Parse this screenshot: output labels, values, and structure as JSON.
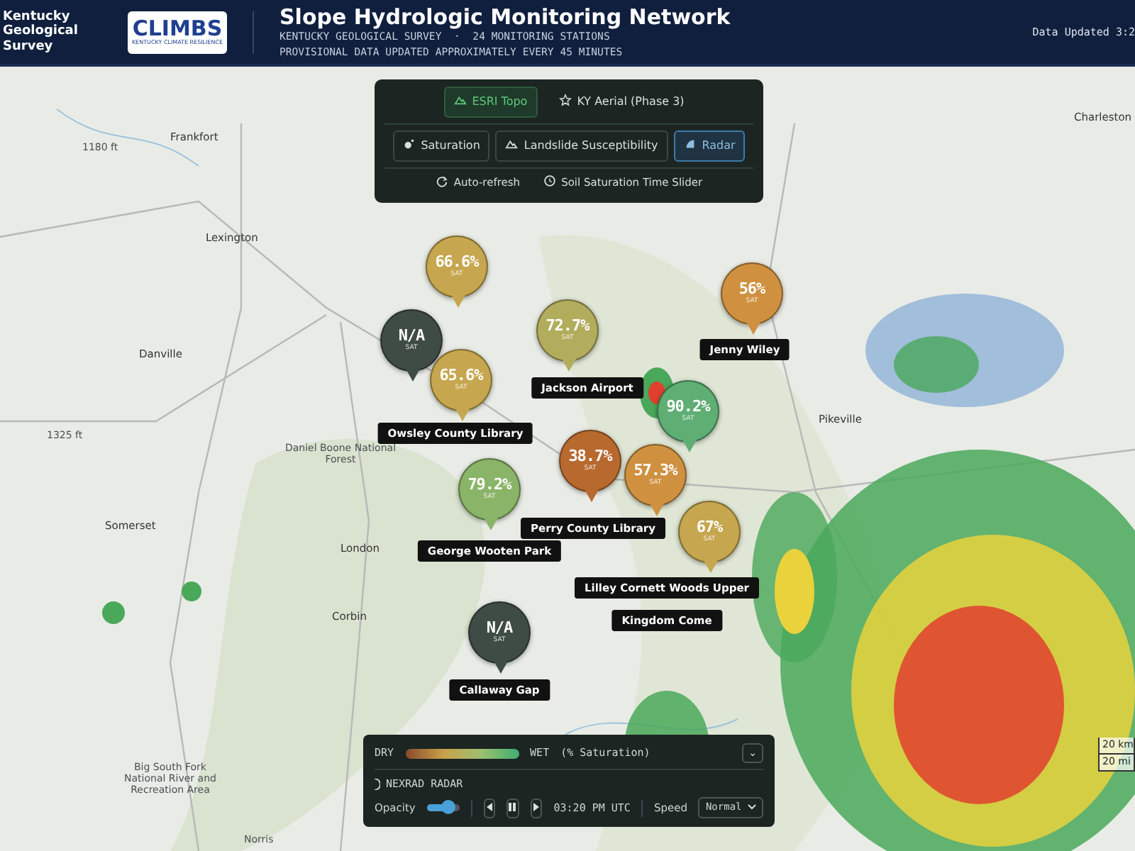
{
  "header": {
    "org_name": "Kentucky Geological Survey",
    "partner_logo": {
      "name": "CLIMBS",
      "tagline": "KENTUCKY CLIMATE RESILIENCE"
    },
    "title": "Slope Hydrologic Monitoring Network",
    "subtitle_1": "KENTUCKY GEOLOGICAL SURVEY  ·  24 MONITORING STATIONS",
    "subtitle_2": "PROVISIONAL DATA UPDATED APPROXIMATELY EVERY 45 MINUTES",
    "updated": "Data Updated 3:2"
  },
  "basemaps": [
    {
      "label": "ESRI Topo",
      "selected": true
    },
    {
      "label": "KY Aerial (Phase 3)",
      "selected": false
    }
  ],
  "layers": [
    {
      "label": "Saturation",
      "selected": false
    },
    {
      "label": "Landslide Susceptibility",
      "selected": false
    },
    {
      "label": "Radar",
      "selected": true
    }
  ],
  "options": [
    {
      "label": "Auto-refresh"
    },
    {
      "label": "Soil Saturation Time Slider"
    }
  ],
  "places": [
    {
      "text": "Charleston"
    },
    {
      "text": "Frankfort"
    },
    {
      "text": "1180 ft"
    },
    {
      "text": "Lexington"
    },
    {
      "text": "Danville"
    },
    {
      "text": "Daniel Boone National Forest"
    },
    {
      "text": "1325 ft"
    },
    {
      "text": "Pikeville"
    },
    {
      "text": "Somerset"
    },
    {
      "text": "London"
    },
    {
      "text": "Corbin"
    },
    {
      "text": "Big South Fork National River and Recreation Area"
    },
    {
      "text": "Norris"
    }
  ],
  "stations": [
    {
      "value": "66.6%",
      "unit": "SAT",
      "color": "#c6a64e"
    },
    {
      "value": "N/A",
      "unit": "SAT",
      "color": "#3f4b45"
    },
    {
      "value": "65.6%",
      "unit": "SAT",
      "color": "#c6a64e"
    },
    {
      "value": "72.7%",
      "unit": "SAT",
      "color": "#b2ad5c"
    },
    {
      "value": "56%",
      "unit": "SAT",
      "color": "#cf9140"
    },
    {
      "value": "90.2%",
      "unit": "SAT",
      "color": "#5fae74"
    },
    {
      "value": "38.7%",
      "unit": "SAT",
      "color": "#b7692e"
    },
    {
      "value": "57.3%",
      "unit": "SAT",
      "color": "#cf9140"
    },
    {
      "value": "79.2%",
      "unit": "SAT",
      "color": "#8ab468"
    },
    {
      "value": "67%",
      "unit": "SAT",
      "color": "#c6a64e"
    },
    {
      "value": "N/A",
      "unit": "SAT",
      "color": "#3f4b45"
    }
  ],
  "station_labels": [
    {
      "text": "Jackson Airport"
    },
    {
      "text": "Jenny Wiley"
    },
    {
      "text": "Owsley County Library"
    },
    {
      "text": "Perry County Library"
    },
    {
      "text": "George Wooten Park"
    },
    {
      "text": "Lilley Cornett Woods Upper"
    },
    {
      "text": "Kingdom Come"
    },
    {
      "text": "Callaway Gap"
    }
  ],
  "legend": {
    "dry": "DRY",
    "wet": "WET",
    "unit": "(% Saturation)",
    "collapse": "⌄",
    "radar_title": "NEXRAD RADAR",
    "opacity_label": "Opacity",
    "opacity": {
      "level": 0.65
    },
    "time": "03:20 PM UTC",
    "speed_label": "Speed",
    "speed": "Normal",
    "playing": true
  },
  "scale": [
    {
      "text": "20 km"
    },
    {
      "text": "20 mi"
    }
  ]
}
